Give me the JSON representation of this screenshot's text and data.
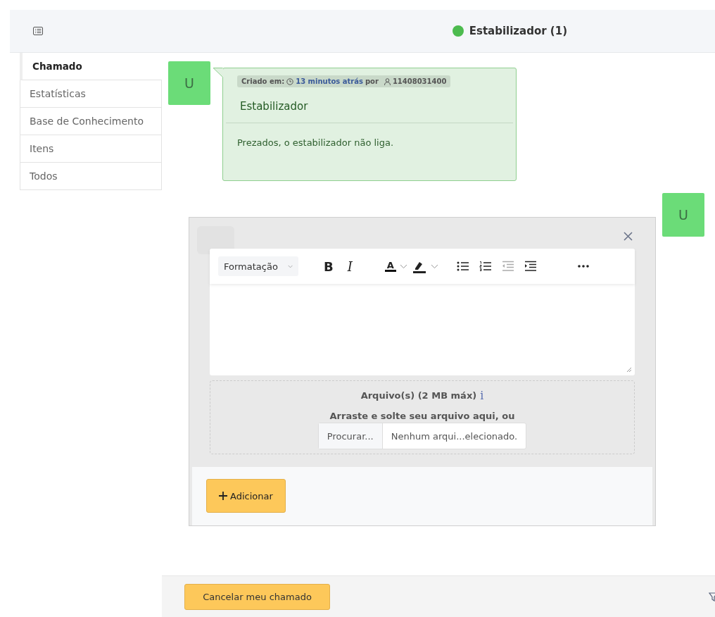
{
  "header": {
    "title": "Estabilizador (1)"
  },
  "sidebar": {
    "tabs": [
      {
        "label": "Chamado",
        "selected": true
      },
      {
        "label": "Estatísticas",
        "selected": false
      },
      {
        "label": "Base de Conhecimento",
        "selected": false
      },
      {
        "label": "Itens",
        "selected": false
      },
      {
        "label": "Todos",
        "selected": false
      }
    ]
  },
  "message": {
    "avatar": "U",
    "created_label": "Criado em:",
    "time": "13 minutos atrás",
    "by": "por",
    "user": "11408031400",
    "subject": "Estabilizador",
    "body": "Prezados, o estabilizador não liga."
  },
  "reply": {
    "avatar": "U",
    "toolbar": [
      {
        "kind": "select",
        "label": "Formatação",
        "disabled": false
      },
      {
        "kind": "bold",
        "label": "B",
        "disabled": false
      },
      {
        "kind": "italic",
        "label": "I",
        "disabled": false
      },
      {
        "kind": "text-color",
        "label": "A",
        "disabled": false
      },
      {
        "kind": "highlight",
        "disabled": false
      },
      {
        "kind": "bullet-list",
        "disabled": false
      },
      {
        "kind": "numbered-list",
        "disabled": false
      },
      {
        "kind": "outdent",
        "disabled": true
      },
      {
        "kind": "indent",
        "disabled": false
      },
      {
        "kind": "more",
        "disabled": false
      }
    ],
    "upload": {
      "label": "Arquivo(s) (2 MB máx)",
      "info": "i",
      "hint": "Arraste e solte seu arquivo aqui, ou",
      "browse": "Procurar...",
      "file": "Nenhum arqui...elecionado."
    },
    "add_button": "Adicionar"
  },
  "footer": {
    "cancel_button": "Cancelar meu chamado"
  }
}
